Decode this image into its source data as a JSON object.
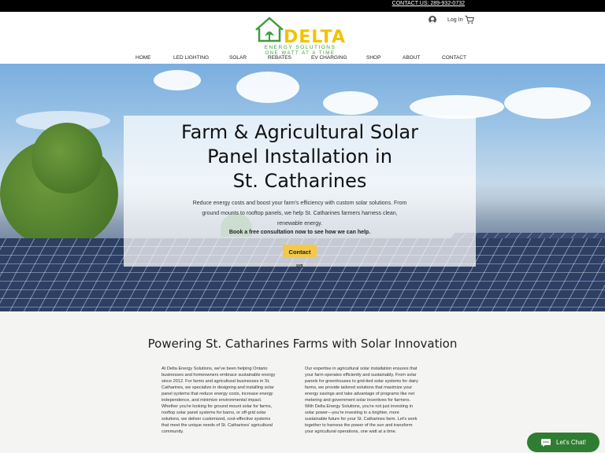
{
  "topbar": {
    "phone": "CONTACT US: 289-932-0732"
  },
  "header": {
    "logo": {
      "brand": "DELTA",
      "line1": "ENERGY SOLUTIONS",
      "line2": "ONE WATT AT A TIME"
    },
    "login_label": "Log In",
    "nav": [
      "HOME",
      "LED LIGHTING",
      "SOLAR",
      "REBATES",
      "EV CHARGING",
      "SHOP",
      "ABOUT",
      "CONTACT"
    ]
  },
  "hero": {
    "title_lines": [
      "Farm & Agricultural Solar",
      "Panel Installation in",
      "St. Catharines"
    ],
    "desc_lines": [
      "Reduce energy costs and boost your farm's efficiency with custom solar solutions. From",
      "ground mounts to rooftop panels, we help St. Catharines farmers harness clean,",
      "renewable energy."
    ],
    "cta_line": "Book a free consultation now to see how we can help.",
    "button": "Contact us"
  },
  "section": {
    "title": "Powering St. Catharines Farms with Solar Innovation",
    "left_lines": [
      "At Delta Energy Solutions, we've been helping Ontario",
      "businesses and homeowners embrace sustainable energy",
      "since 2012. For farms and agricultural businesses in St.",
      "Catharines, we specialize in designing and installing solar",
      "panel systems that reduce energy costs, increase energy",
      "independence, and minimize environmental impact.",
      "Whether you're looking for ground mount solar for farms,",
      "rooftop solar panel systems for barns, or off-grid solar",
      "solutions, we deliver customized, cost-effective systems",
      "that meet the unique needs of St. Catharines' agricultural",
      "community."
    ],
    "right_lines": [
      "Our expertise in agricultural solar installation ensures that",
      "your farm operates efficiently and sustainably. From solar",
      "panels for greenhouses to grid-tied solar systems for dairy",
      "farms, we provide tailored solutions that maximize your",
      "energy savings and take advantage of programs like net",
      "metering and government solar incentives for farmers.",
      "With Delta Energy Solutions, you're not just investing in",
      "solar power—you're investing in a brighter, more",
      "sustainable future for your St. Catharines farm. Let's work",
      "together to harness the power of the sun and transform",
      "your agricultural operations, one watt at a time."
    ]
  },
  "chat": {
    "label": "Let's Chat!"
  },
  "colors": {
    "accent_yellow": "#f4c94a",
    "brand_green": "#3f9c3c",
    "chat_green": "#2f7d32"
  }
}
